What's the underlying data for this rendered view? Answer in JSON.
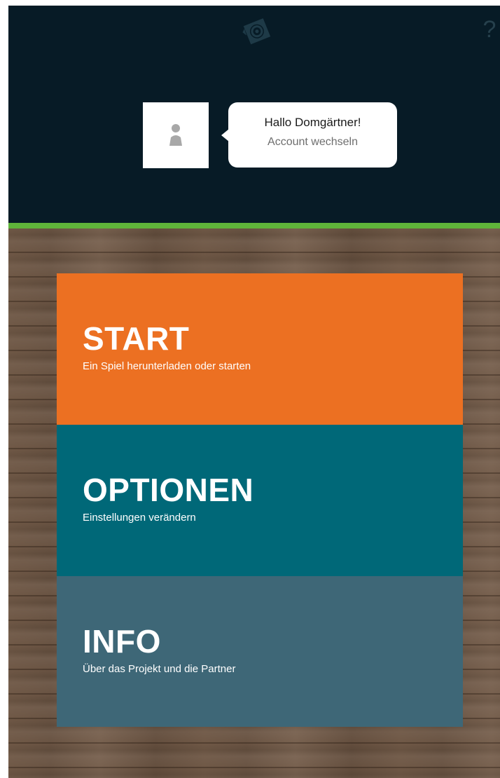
{
  "header": {
    "logo_icon": "game-logo-icon",
    "help_label": "?",
    "avatar_icon": "user-icon",
    "greeting": "Hallo Domgärtner!",
    "switch_account": "Account wechseln"
  },
  "colors": {
    "header_bg": "#071b26",
    "accent_green": "#5fb43a",
    "start": "#ec7022",
    "options": "#006878",
    "info": "#3e6777"
  },
  "menu": {
    "items": [
      {
        "title": "START",
        "subtitle": "Ein Spiel herunterladen oder starten"
      },
      {
        "title": "OPTIONEN",
        "subtitle": "Einstellungen verändern"
      },
      {
        "title": "INFO",
        "subtitle": "Über das Projekt und die Partner"
      }
    ]
  }
}
